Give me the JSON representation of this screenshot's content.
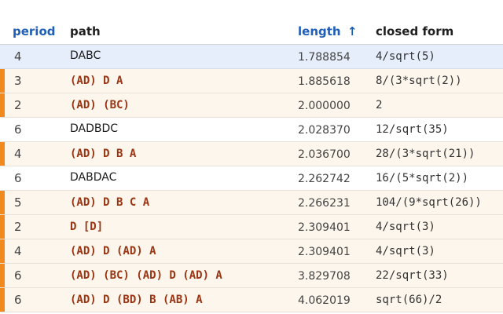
{
  "columns": {
    "period": "period",
    "path": "path",
    "length": "length",
    "sort_arrow": "↑",
    "closed_form": "closed form"
  },
  "rows": [
    {
      "period": "4",
      "path": "DABC",
      "length": "1.788854",
      "closed_form": "4/sqrt(5)",
      "style": "selected"
    },
    {
      "period": "3",
      "path": "(AD) D A",
      "length": "1.885618",
      "closed_form": "8/(3*sqrt(2))",
      "style": "flagged"
    },
    {
      "period": "2",
      "path": "(AD) (BC)",
      "length": "2.000000",
      "closed_form": "2",
      "style": "flagged"
    },
    {
      "period": "6",
      "path": "DADBDC",
      "length": "2.028370",
      "closed_form": "12/sqrt(35)",
      "style": "plain"
    },
    {
      "period": "4",
      "path": "(AD) D B A",
      "length": "2.036700",
      "closed_form": "28/(3*sqrt(21))",
      "style": "flagged"
    },
    {
      "period": "6",
      "path": "DABDAC",
      "length": "2.262742",
      "closed_form": "16/(5*sqrt(2))",
      "style": "plain"
    },
    {
      "period": "5",
      "path": "(AD) D B C A",
      "length": "2.266231",
      "closed_form": "104/(9*sqrt(26))",
      "style": "flagged"
    },
    {
      "period": "2",
      "path": "D [D]",
      "length": "2.309401",
      "closed_form": "4/sqrt(3)",
      "style": "flagged"
    },
    {
      "period": "4",
      "path": "(AD) D (AD) A",
      "length": "2.309401",
      "closed_form": "4/sqrt(3)",
      "style": "flagged"
    },
    {
      "period": "6",
      "path": "(AD) (BC) (AD) D (AD) A",
      "length": "3.829708",
      "closed_form": "22/sqrt(33)",
      "style": "flagged"
    },
    {
      "period": "6",
      "path": "(AD) D (BD) B (AB) A",
      "length": "4.062019",
      "closed_form": "sqrt(66)/2",
      "style": "flagged"
    }
  ],
  "colors": {
    "sorted_header": "#1f5fb8",
    "flag_marker": "#f08a1e",
    "flag_row_bg": "#fdf6ec",
    "selected_row_bg": "#e6eefb",
    "mono_path_text": "#9a3412"
  }
}
